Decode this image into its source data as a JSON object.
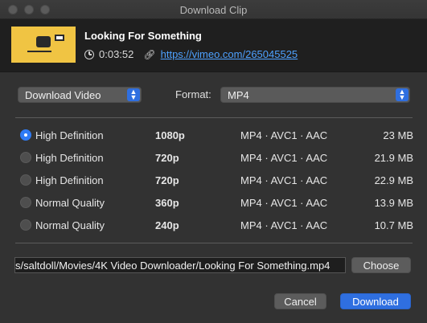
{
  "window": {
    "title": "Download Clip"
  },
  "video": {
    "title": "Looking For Something",
    "duration": "0:03:52",
    "url": "https://vimeo.com/265045525"
  },
  "options": {
    "download_type": "Download Video",
    "format_label": "Format:",
    "format_value": "MP4"
  },
  "qualities": [
    {
      "quality": "High Definition",
      "resolution": "1080p",
      "codec": "MP4 · AVC1 · AAC",
      "size": "23 MB",
      "selected": true
    },
    {
      "quality": "High Definition",
      "resolution": "720p",
      "codec": "MP4 · AVC1 · AAC",
      "size": "21.9 MB",
      "selected": false
    },
    {
      "quality": "High Definition",
      "resolution": "720p",
      "codec": "MP4 · AVC1 · AAC",
      "size": "22.9 MB",
      "selected": false
    },
    {
      "quality": "Normal Quality",
      "resolution": "360p",
      "codec": "MP4 · AVC1 · AAC",
      "size": "13.9 MB",
      "selected": false
    },
    {
      "quality": "Normal Quality",
      "resolution": "240p",
      "codec": "MP4 · AVC1 · AAC",
      "size": "10.7 MB",
      "selected": false
    }
  ],
  "save": {
    "path": "s/saltdoll/Movies/4K Video Downloader/Looking For Something.mp4",
    "choose_label": "Choose"
  },
  "actions": {
    "cancel_label": "Cancel",
    "download_label": "Download"
  },
  "colors": {
    "accent": "#2f6fe0",
    "link": "#4ea1ff"
  },
  "icons": {
    "duration": "clock-icon",
    "url": "link-icon",
    "popup": "up-down-arrows-icon"
  }
}
